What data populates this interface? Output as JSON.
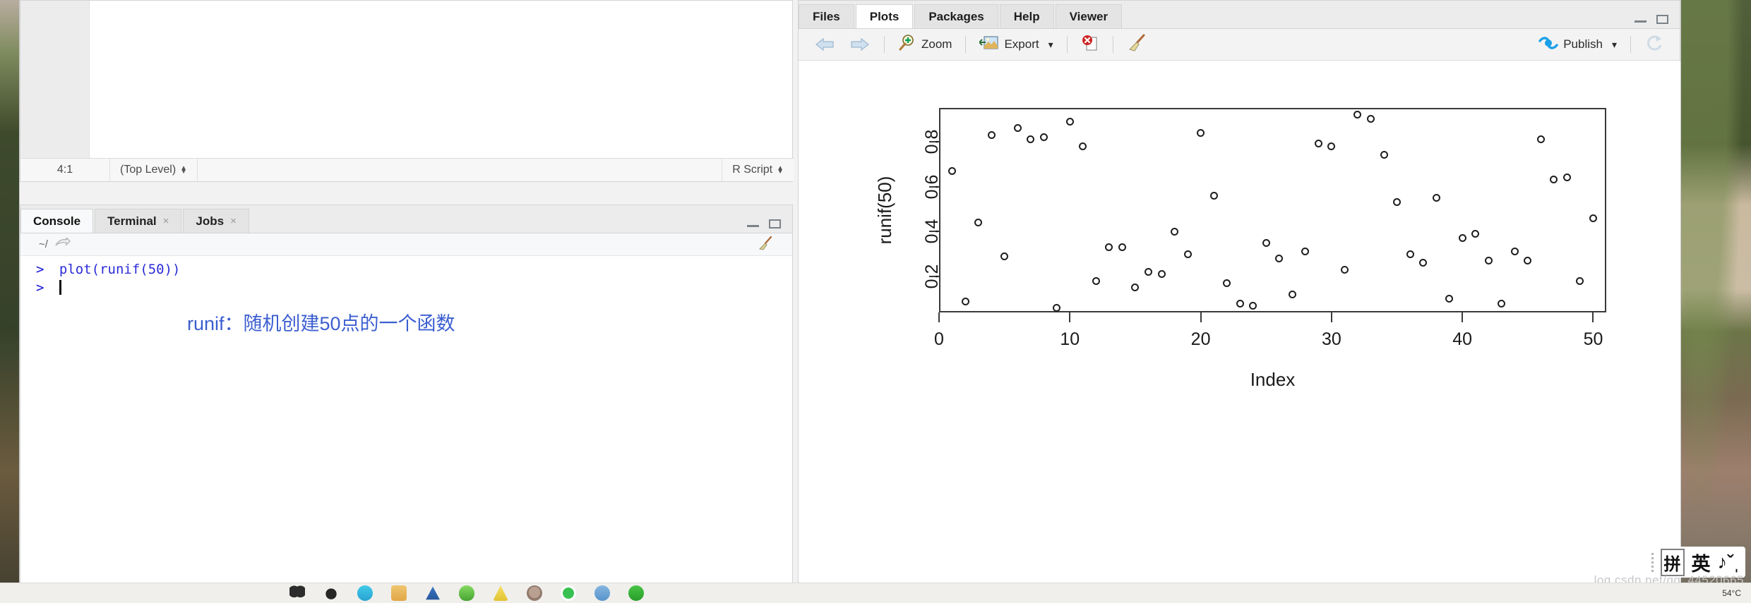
{
  "source_pane": {
    "cursor_position": "4:1",
    "scope": "(Top Level)",
    "file_type": "R Script"
  },
  "console_pane": {
    "tabs": [
      {
        "label": "Console",
        "closable": false,
        "active": true
      },
      {
        "label": "Terminal",
        "closable": true,
        "active": false
      },
      {
        "label": "Jobs",
        "closable": true,
        "active": false
      }
    ],
    "close_glyph": "×",
    "working_directory": "~/",
    "lines": [
      {
        "prompt": ">",
        "code": "plot(runif(50))"
      },
      {
        "prompt": ">",
        "code": ""
      }
    ],
    "annotation": "runif：随机创建50点的一个函数",
    "annotation_color": "#3b5ed0"
  },
  "plots_pane": {
    "tabs": [
      {
        "label": "Files",
        "active": false
      },
      {
        "label": "Plots",
        "active": true
      },
      {
        "label": "Packages",
        "active": false
      },
      {
        "label": "Help",
        "active": false
      },
      {
        "label": "Viewer",
        "active": false
      }
    ],
    "toolbar": {
      "back_label": "back-arrow",
      "forward_label": "forward-arrow",
      "zoom_label": "Zoom",
      "export_label": "Export",
      "export_caret": "▾",
      "remove_label": "remove-plot",
      "clear_label": "clear-all-plots",
      "publish_label": "Publish",
      "publish_caret": "▾",
      "refresh_label": "refresh"
    }
  },
  "ime": {
    "mode_glyph": "拼",
    "language_glyph": "英",
    "extra_glyphs": "♪ˇˌ"
  },
  "watermark": "log.csdn.net/qq_44520665",
  "chart_data": {
    "type": "scatter",
    "title": "",
    "xlabel": "Index",
    "ylabel": "runif(50)",
    "xlim": [
      0,
      51
    ],
    "ylim": [
      0.04,
      0.95
    ],
    "xticks": [
      0,
      10,
      20,
      30,
      40,
      50
    ],
    "yticks": [
      0.2,
      0.4,
      0.6,
      0.8
    ],
    "grid": false,
    "legend": null,
    "marker": "open-circle",
    "x": [
      1,
      2,
      3,
      4,
      5,
      6,
      7,
      8,
      9,
      10,
      11,
      12,
      13,
      14,
      15,
      16,
      17,
      18,
      19,
      20,
      21,
      22,
      23,
      24,
      25,
      26,
      27,
      28,
      29,
      30,
      31,
      32,
      33,
      34,
      35,
      36,
      37,
      38,
      39,
      40,
      41,
      42,
      43,
      44,
      45,
      46,
      47,
      48,
      49,
      50
    ],
    "y": [
      0.67,
      0.09,
      0.44,
      0.83,
      0.29,
      0.86,
      0.81,
      0.82,
      0.06,
      0.89,
      0.78,
      0.18,
      0.33,
      0.33,
      0.15,
      0.22,
      0.21,
      0.4,
      0.3,
      0.84,
      0.56,
      0.17,
      0.08,
      0.07,
      0.35,
      0.28,
      0.12,
      0.31,
      0.79,
      0.78,
      0.23,
      0.92,
      0.9,
      0.74,
      0.53,
      0.3,
      0.26,
      0.55,
      0.1,
      0.37,
      0.39,
      0.27,
      0.08,
      0.31,
      0.27,
      0.81,
      0.63,
      0.64,
      0.18,
      0.46
    ]
  }
}
